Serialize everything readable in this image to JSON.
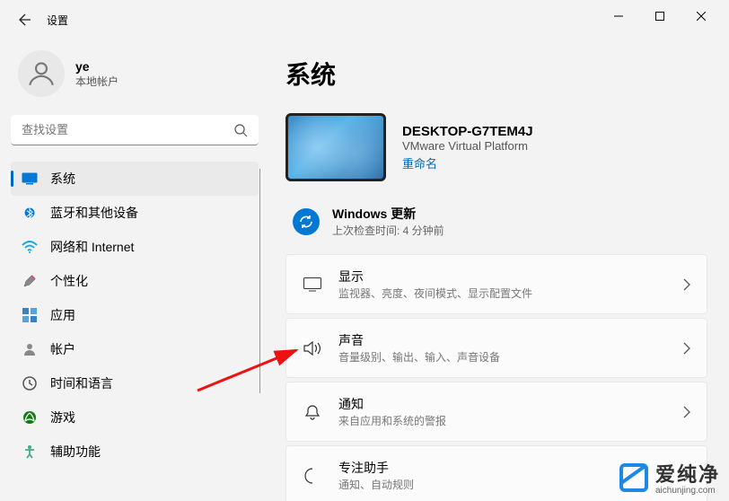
{
  "app_title": "设置",
  "user": {
    "name": "ye",
    "type": "本地帐户"
  },
  "search": {
    "placeholder": "查找设置"
  },
  "nav": [
    {
      "label": "系统",
      "icon": "system"
    },
    {
      "label": "蓝牙和其他设备",
      "icon": "bluetooth"
    },
    {
      "label": "网络和 Internet",
      "icon": "network"
    },
    {
      "label": "个性化",
      "icon": "personalize"
    },
    {
      "label": "应用",
      "icon": "apps"
    },
    {
      "label": "帐户",
      "icon": "accounts"
    },
    {
      "label": "时间和语言",
      "icon": "time"
    },
    {
      "label": "游戏",
      "icon": "gaming"
    },
    {
      "label": "辅助功能",
      "icon": "accessibility"
    }
  ],
  "page": {
    "title": "系统",
    "device": {
      "name": "DESKTOP-G7TEM4J",
      "platform": "VMware Virtual Platform",
      "rename": "重命名"
    },
    "update": {
      "title": "Windows 更新",
      "sub": "上次检查时间: 4 分钟前"
    },
    "cards": [
      {
        "title": "显示",
        "sub": "监视器、亮度、夜间模式、显示配置文件"
      },
      {
        "title": "声音",
        "sub": "音量级别、输出、输入、声音设备"
      },
      {
        "title": "通知",
        "sub": "来自应用和系统的警报"
      },
      {
        "title": "专注助手",
        "sub": "通知、自动规则"
      }
    ]
  },
  "watermark": {
    "cn": "爱纯净",
    "en": "aichunjing.com"
  }
}
